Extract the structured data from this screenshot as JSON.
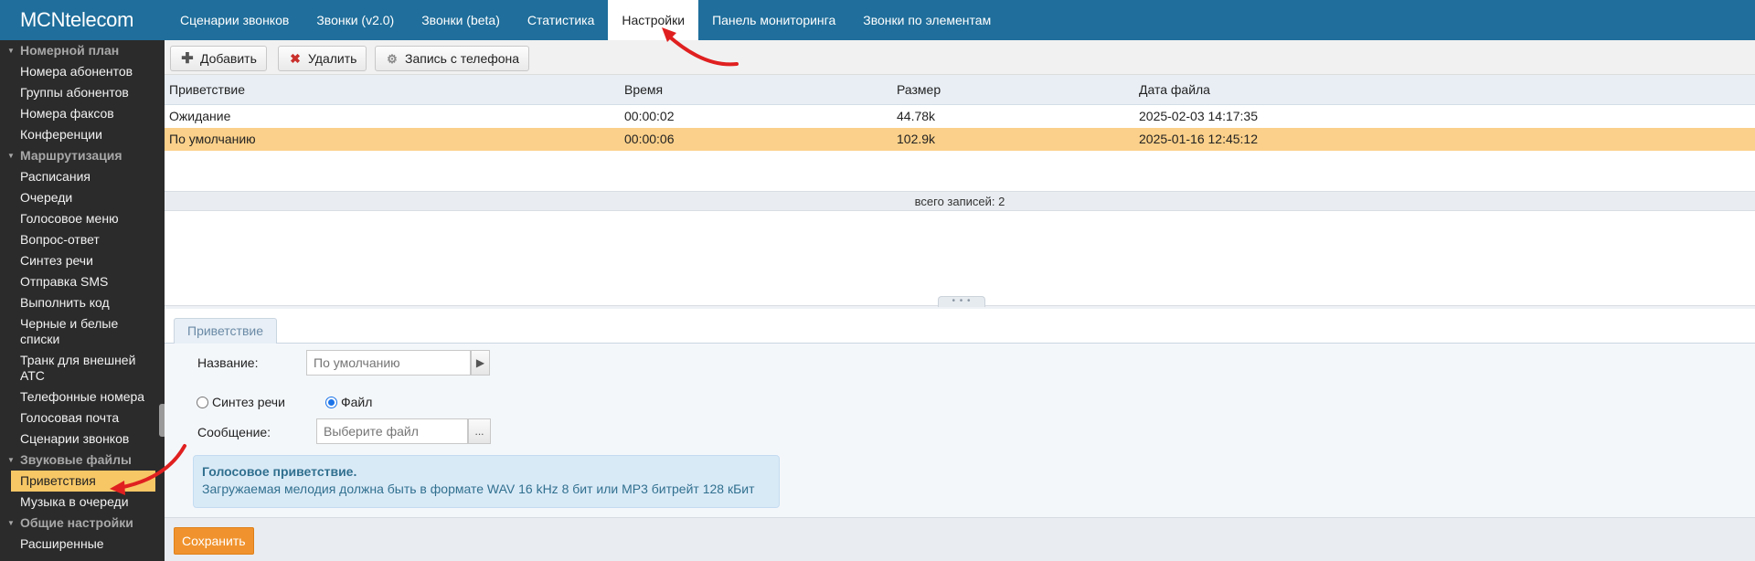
{
  "app": {
    "logo": "MCNtelecom"
  },
  "nav": {
    "items": [
      {
        "label": "Сценарии звонков"
      },
      {
        "label": "Звонки (v2.0)"
      },
      {
        "label": "Звонки (beta)"
      },
      {
        "label": "Статистика"
      },
      {
        "label": "Настройки",
        "active": true
      },
      {
        "label": "Панель мониторинга"
      },
      {
        "label": "Звонки по элементам"
      }
    ]
  },
  "sidebar": {
    "groups": [
      {
        "title": "Номерной план",
        "items": [
          "Номера абонентов",
          "Группы абонентов",
          "Номера факсов",
          "Конференции"
        ]
      },
      {
        "title": "Маршрутизация",
        "items": [
          "Расписания",
          "Очереди",
          "Голосовое меню",
          "Вопрос-ответ",
          "Синтез речи",
          "Отправка SMS",
          "Выполнить код",
          "Черные и белые списки",
          "Транк для внешней АТС",
          "Телефонные номера",
          "Голосовая почта",
          "Сценарии звонков"
        ]
      },
      {
        "title": "Звуковые файлы",
        "items": [
          "Приветствия",
          "Музыка в очереди"
        ]
      },
      {
        "title": "Общие настройки",
        "items": [
          "Расширенные"
        ]
      }
    ],
    "active_item": "Приветствия"
  },
  "toolbar": {
    "add_label": "Добавить",
    "delete_label": "Удалить",
    "record_label": "Запись с телефона"
  },
  "grid": {
    "columns": [
      "Приветствие",
      "Время",
      "Размер",
      "Дата файла"
    ],
    "rows": [
      {
        "name": "Ожидание",
        "time": "00:00:02",
        "size": "44.78k",
        "date": "2025-02-03 14:17:35",
        "selected": false
      },
      {
        "name": "По умолчанию",
        "time": "00:00:06",
        "size": "102.9k",
        "date": "2025-01-16 12:45:12",
        "selected": true
      }
    ],
    "footer": "всего записей: 2"
  },
  "form": {
    "tab": "Приветствие",
    "name_label": "Название:",
    "name_placeholder": "По умолчанию",
    "radio_tts": "Синтез речи",
    "radio_file": "Файл",
    "selected_source": "Файл",
    "message_label": "Сообщение:",
    "message_placeholder": "Выберите файл",
    "browse_label": "...",
    "info_title": "Голосовое приветствие.",
    "info_text": "Загружаемая мелодия должна быть в формате WAV 16 kHz 8 бит или MP3 битрейт 128 кБит",
    "save_label": "Сохранить"
  },
  "colors": {
    "topbar": "#1f6e9b",
    "sidebar": "#2b2b2b",
    "selected_row": "#fbd08a",
    "active_sidebar_item": "#f7c766",
    "save_button": "#f0932e",
    "annotation_arrow": "#e02020"
  }
}
